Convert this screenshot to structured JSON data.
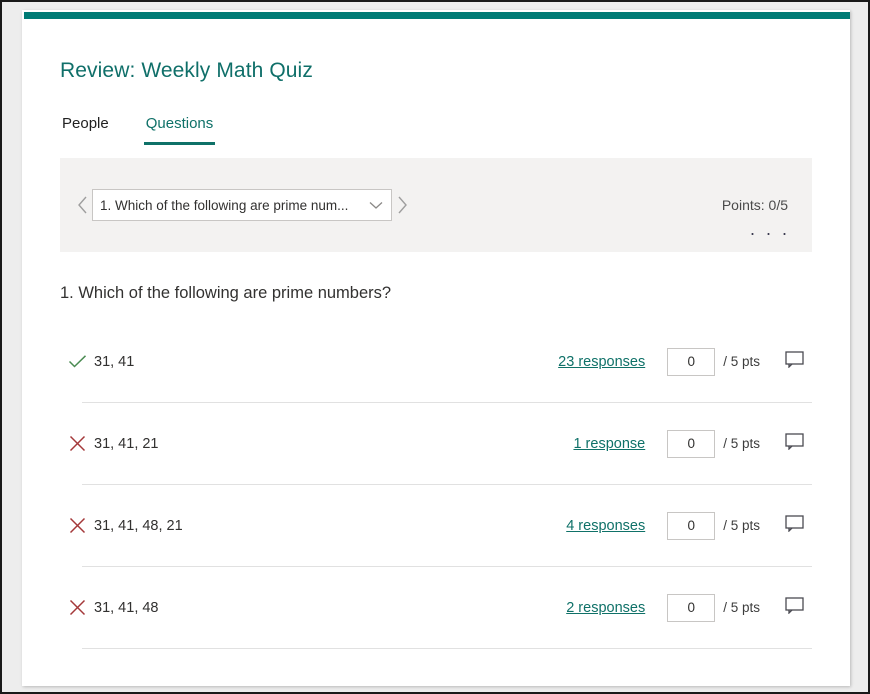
{
  "window": {
    "accent_color": "#007b75",
    "border_color": "#1a1a1a"
  },
  "header": {
    "title": "Review: Weekly Math Quiz"
  },
  "tabs": [
    {
      "label": "People",
      "active": false
    },
    {
      "label": "Questions",
      "active": true
    }
  ],
  "selector": {
    "prev_icon": "chevron-left-icon",
    "next_icon": "chevron-right-icon",
    "dropdown_icon": "chevron-down-icon",
    "selected_question": "1. Which of the following are prime num...",
    "points_label": "Points: 0/5",
    "overflow_label": "· · ·"
  },
  "question": {
    "heading": "1. Which of the following are prime numbers?"
  },
  "answers": [
    {
      "status": "correct",
      "status_icon": "check-icon",
      "text": "31, 41",
      "responses_label": "23 responses",
      "score_value": "0",
      "points_label": "/ 5 pts",
      "comment_icon": "comment-icon"
    },
    {
      "status": "incorrect",
      "status_icon": "close-icon",
      "text": "31, 41, 21",
      "responses_label": "1 response",
      "score_value": "0",
      "points_label": "/ 5 pts",
      "comment_icon": "comment-icon"
    },
    {
      "status": "incorrect",
      "status_icon": "close-icon",
      "text": "31, 41, 48, 21",
      "responses_label": "4 responses",
      "score_value": "0",
      "points_label": "/ 5 pts",
      "comment_icon": "comment-icon"
    },
    {
      "status": "incorrect",
      "status_icon": "close-icon",
      "text": "31, 41, 48",
      "responses_label": "2 responses",
      "score_value": "0",
      "points_label": "/ 5 pts",
      "comment_icon": "comment-icon"
    }
  ],
  "colors": {
    "teal": "#0f7168",
    "correct_green": "#4a8b52",
    "incorrect_red": "#a4383a",
    "panel_gray": "#f3f2f1"
  }
}
